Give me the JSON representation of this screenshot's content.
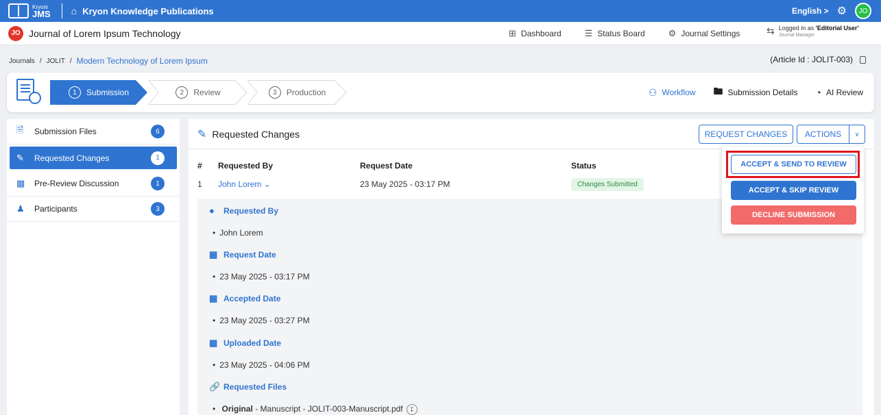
{
  "topbar": {
    "logo_small": "Kryoni",
    "logo_big": "JMS",
    "publisher": "Kryon Knowledge Publications",
    "language": "English >",
    "user_initials": "JO"
  },
  "journal": {
    "badge": "JO",
    "name": "Journal of Lorem Ipsum Technology"
  },
  "nav": {
    "dashboard": "Dashboard",
    "status_board": "Status Board",
    "journal_settings": "Journal Settings"
  },
  "user": {
    "logged_prefix": "Logged in as ",
    "logged_name": "'Editorial User'",
    "role": "Journal Manager"
  },
  "breadcrumb": {
    "journals": "Journals",
    "code": "JOLIT",
    "current": "Modern Technology of Lorem Ipsum"
  },
  "article_id": "(Article Id : JOLIT-003)",
  "steps": [
    {
      "num": "1",
      "label": "Submission"
    },
    {
      "num": "2",
      "label": "Review"
    },
    {
      "num": "3",
      "label": "Production"
    }
  ],
  "tools": {
    "workflow": "Workflow",
    "submission_details": "Submission Details",
    "ai_review": "AI Review"
  },
  "sidebar": {
    "items": [
      {
        "label": "Submission Files",
        "count": "6"
      },
      {
        "label": "Requested Changes",
        "count": "1"
      },
      {
        "label": "Pre-Review Discussion",
        "count": "1"
      },
      {
        "label": "Participants",
        "count": "3"
      }
    ]
  },
  "main": {
    "title": "Requested Changes",
    "request_changes_label": "REQUEST CHANGES",
    "actions_label": "ACTIONS",
    "caret": "∨"
  },
  "table": {
    "headers": {
      "num": "#",
      "requested_by": "Requested By",
      "request_date": "Request Date",
      "status": "Status"
    },
    "rows": [
      {
        "num": "1",
        "requested_by": "John Lorem",
        "request_date": "23 May 2025 - 03:17 PM",
        "status": "Changes Submitted"
      }
    ]
  },
  "details": {
    "requested_by_head": "Requested By",
    "requested_by_val": "John Lorem",
    "request_date_head": "Request Date",
    "request_date_val": "23 May 2025 - 03:17 PM",
    "accepted_date_head": "Accepted Date",
    "accepted_date_val": "23 May 2025 - 03:27 PM",
    "uploaded_date_head": "Uploaded Date",
    "uploaded_date_val": "23 May 2025 - 04:06 PM",
    "files_head": "Requested Files",
    "file_type": "Original",
    "file_desc": " - Manuscript - JOLIT-003-Manuscript.pdf"
  },
  "dropdown": {
    "accept_send": "ACCEPT & SEND TO REVIEW",
    "accept_skip": "ACCEPT & SKIP REVIEW",
    "decline": "DECLINE SUBMISSION"
  },
  "colors": {
    "primary": "#2f74d0",
    "danger": "#f26a6a",
    "highlight": "#e0151d",
    "success": "#2b8a3e",
    "avatar": "#25c048"
  }
}
